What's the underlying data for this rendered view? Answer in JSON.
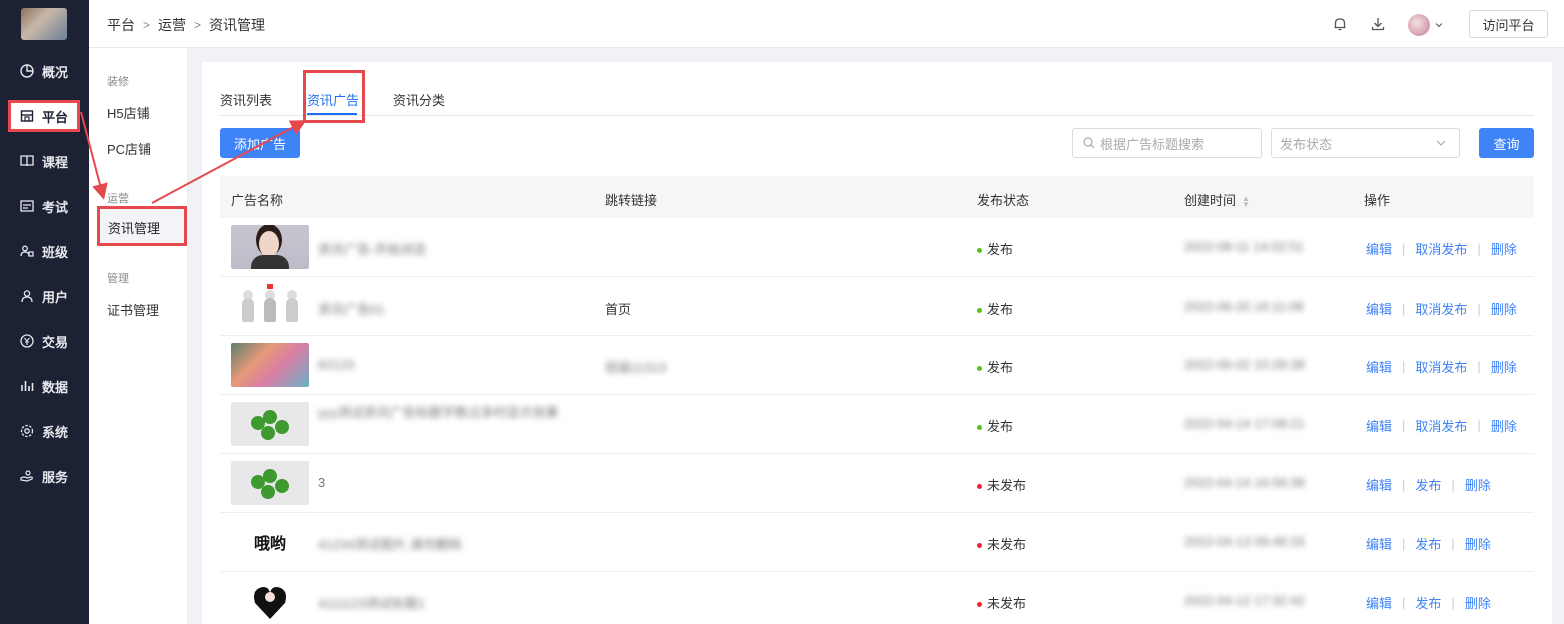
{
  "nav": {
    "items": [
      {
        "label": "概况",
        "icon": "pie-icon"
      },
      {
        "label": "平台",
        "icon": "store-icon"
      },
      {
        "label": "课程",
        "icon": "book-icon"
      },
      {
        "label": "考试",
        "icon": "exam-icon"
      },
      {
        "label": "班级",
        "icon": "group-icon"
      },
      {
        "label": "用户",
        "icon": "user-icon"
      },
      {
        "label": "交易",
        "icon": "yen-icon"
      },
      {
        "label": "数据",
        "icon": "bar-chart-icon"
      },
      {
        "label": "系统",
        "icon": "gear-icon"
      },
      {
        "label": "服务",
        "icon": "hand-icon"
      }
    ]
  },
  "header": {
    "breadcrumb": [
      "平台",
      "运营",
      "资讯管理"
    ],
    "visit_label": "访问平台"
  },
  "subnav": {
    "groups": [
      {
        "title": "装修",
        "items": [
          "H5店铺",
          "PC店铺"
        ]
      },
      {
        "title": "运营",
        "items": [
          "资讯管理"
        ]
      },
      {
        "title": "管理",
        "items": [
          "证书管理"
        ]
      }
    ]
  },
  "tabs": [
    "资讯列表",
    "资讯广告",
    "资讯分类"
  ],
  "toolbar": {
    "add_label": "添加广告",
    "search_placeholder": "根据广告标题搜索",
    "status_placeholder": "发布状态",
    "query_label": "查询"
  },
  "table": {
    "headers": [
      "广告名称",
      "跳转链接",
      "发布状态",
      "创建时间",
      "操作"
    ],
    "rows": [
      {
        "name": "资讯广告-开始浏览",
        "link": "",
        "status": "发布",
        "time": "2022-08-11 14:02:51",
        "ops": [
          "编辑",
          "取消发布",
          "删除"
        ]
      },
      {
        "name": "资讯广告01",
        "link": "首页",
        "status": "发布",
        "time": "2022-06-20 16:11:08",
        "ops": [
          "编辑",
          "取消发布",
          "删除"
        ]
      },
      {
        "name": "62123",
        "link": "班级11313",
        "status": "发布",
        "time": "2022-06-02 15:28:38",
        "ops": [
          "编辑",
          "取消发布",
          "删除"
        ]
      },
      {
        "name": "yyy测试资讯广告标题字数过多时显示效果",
        "link": "",
        "status": "发布",
        "time": "2022-04-14 17:08:21",
        "ops": [
          "编辑",
          "取消发布",
          "删除"
        ]
      },
      {
        "name": "3",
        "link": "",
        "status": "未发布",
        "time": "2022-04-14 16:58:38",
        "ops": [
          "编辑",
          "发布",
          "删除"
        ]
      },
      {
        "name": "41234测试图片,请勿删除",
        "link": "",
        "status": "未发布",
        "time": "2022-04-13 09:48:33",
        "ops": [
          "编辑",
          "发布",
          "删除"
        ]
      },
      {
        "name": "4111123测试标题1",
        "link": "",
        "status": "未发布",
        "time": "2022-04-12 17:32:42",
        "ops": [
          "编辑",
          "发布",
          "删除"
        ]
      }
    ]
  },
  "thumb_texts": {
    "row6": "哦哟"
  },
  "colors": {
    "nav_bg": "#1c2233",
    "primary": "#3e83f7",
    "published": "#52c41a",
    "unpublished": "#f5222d",
    "highlight": "#e5484d"
  }
}
